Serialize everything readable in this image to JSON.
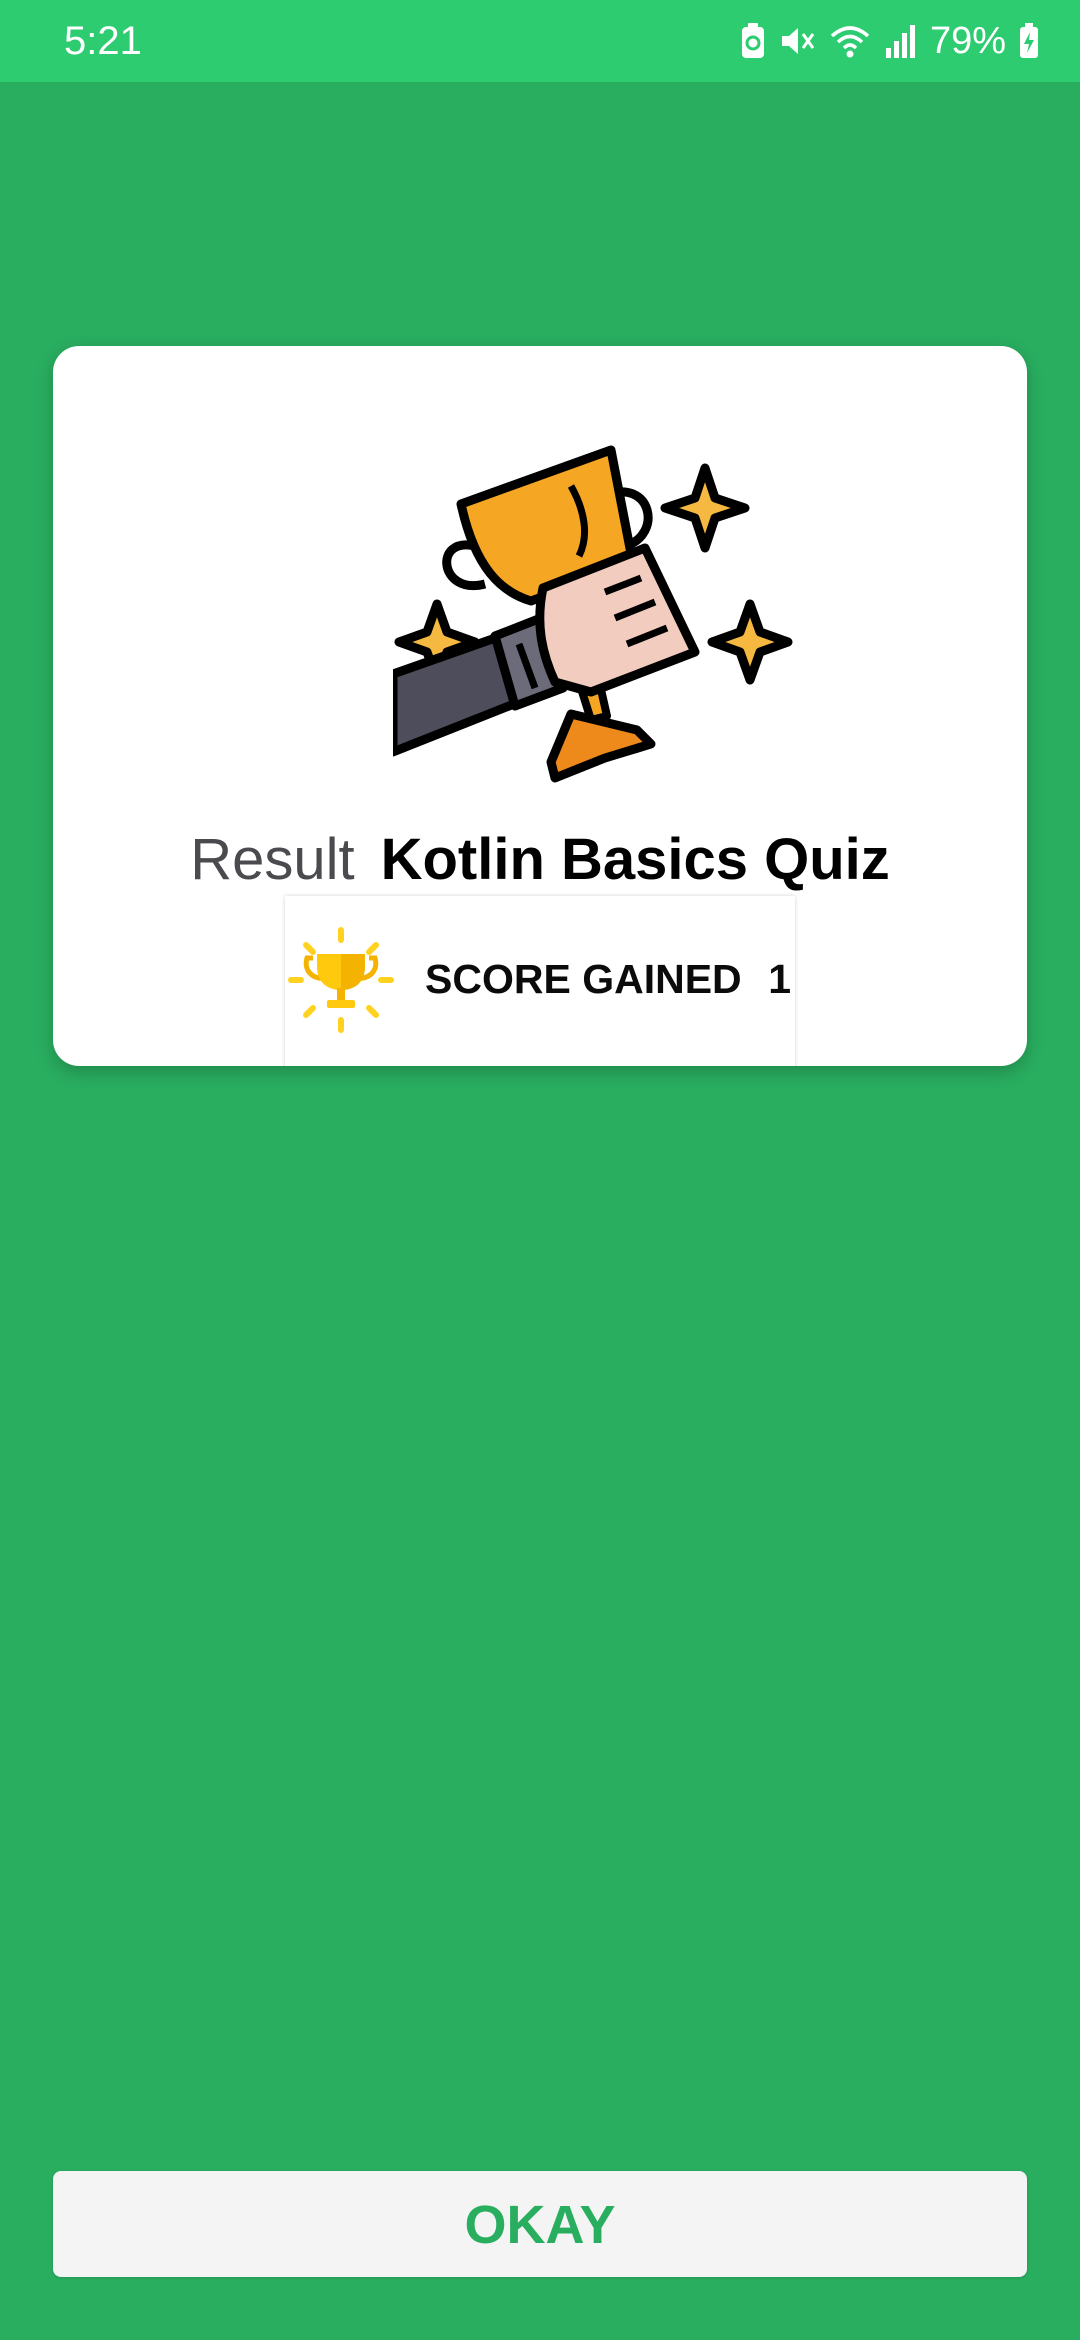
{
  "status_bar": {
    "time": "5:21",
    "battery": "79%",
    "icons": [
      "battery-saver-icon",
      "mute-icon",
      "wifi-icon",
      "signal-icon",
      "battery-charging-icon"
    ]
  },
  "result": {
    "label": "Result",
    "quiz_title": "Kotlin Basics Quiz",
    "illustration_icon": "trophy-hand-icon",
    "score_icon": "trophy-icon",
    "score_label": "SCORE GAINED",
    "score_value": "1"
  },
  "actions": {
    "okay_label": "OKAY"
  },
  "colors": {
    "background": "#29ae60",
    "status_bar": "#2ecc71",
    "accent": "#29ae60",
    "trophy": "#f5a623"
  }
}
